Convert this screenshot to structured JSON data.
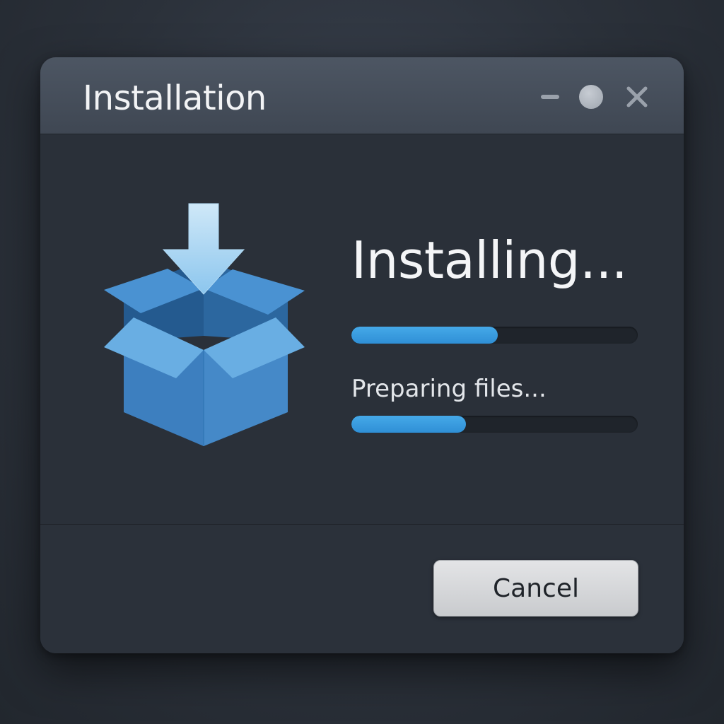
{
  "window": {
    "title": "Installation"
  },
  "controls": {
    "minimize_icon": "minimize-icon",
    "maximize_icon": "circle-icon",
    "close_icon": "close-icon"
  },
  "main": {
    "illustration_icon": "box-download-icon",
    "heading": "Installing...",
    "overall_progress": 0.51,
    "status_text": "Preparing files...",
    "step_progress": 0.4
  },
  "footer": {
    "cancel_label": "Cancel"
  },
  "colors": {
    "accent": "#3a9fe2",
    "box_blue": "#4189c9"
  }
}
